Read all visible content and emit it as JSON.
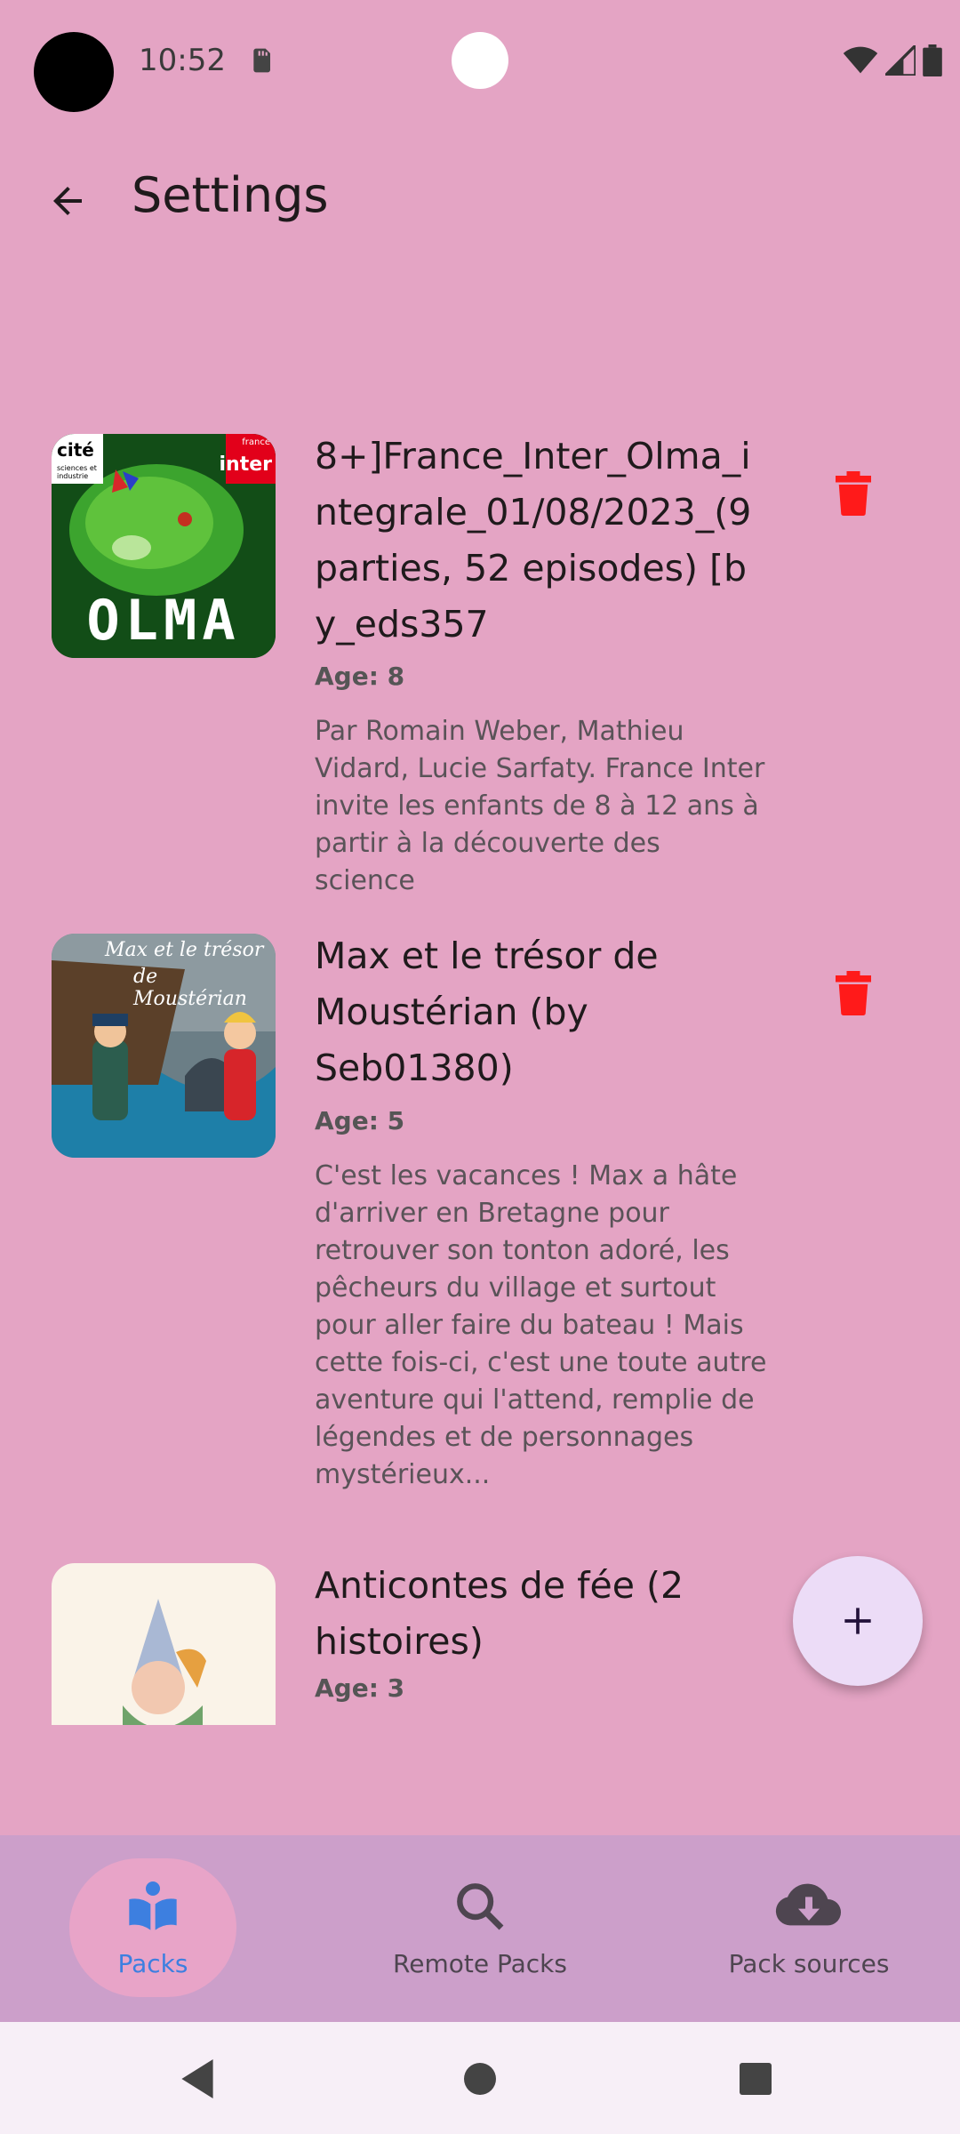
{
  "status_bar": {
    "time": "10:52"
  },
  "app_bar": {
    "title": "Settings"
  },
  "packs": [
    {
      "title": "8+]France_Inter_Olma_integrale_01/08/2023_(9 parties, 52 episodes) [by_eds357",
      "age": "Age: 8",
      "description": "Par Romain Weber, Mathieu Vidard, Lucie Sarfaty. France Inter invite les enfants de 8 à 12 ans à partir à la découverte des science",
      "thumb_text": "OLMA",
      "thumb_badge_left": "cité",
      "thumb_badge_left_sub": "sciences et industrie",
      "thumb_badge_right": "inter",
      "thumb_badge_right_sub": "france"
    },
    {
      "title": "Max et le trésor de Moustérian (by Seb01380)",
      "age": "Age: 5",
      "description": "C'est les vacances ! Max a hâte d'arriver en Bretagne pour retrouver son tonton adoré, les pêcheurs du village et surtout pour aller faire du bateau ! Mais cette fois-ci, c'est une toute autre aventure qui l'attend, remplie de légendes et de personnages mystérieux...",
      "thumb_text_1": "Max et le trésor",
      "thumb_text_2": "de Moustérian"
    },
    {
      "title": "Anticontes de fée (2 histoires)",
      "age": "Age: 3"
    }
  ],
  "bottom_nav": {
    "items": [
      {
        "label": "Packs",
        "icon": "book-reader-icon",
        "selected": true
      },
      {
        "label": "Remote Packs",
        "icon": "search-icon",
        "selected": false
      },
      {
        "label": "Pack sources",
        "icon": "cloud-download-icon",
        "selected": false
      }
    ]
  },
  "colors": {
    "background": "#e4a4c4",
    "accent": "#3d7fe0",
    "delete": "#ff1a1a",
    "nav_bg": "#cc9fca",
    "fab_bg": "#ecdcf7"
  }
}
